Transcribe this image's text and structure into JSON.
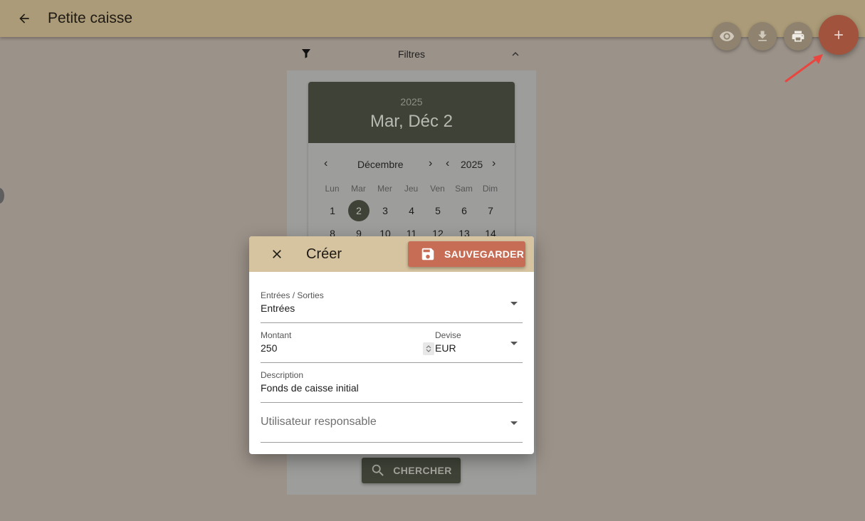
{
  "app": {
    "title": "Petite caisse"
  },
  "toolbar": {
    "view_icon": "eye-icon",
    "download_icon": "download-icon",
    "print_icon": "print-icon",
    "add_icon": "plus-icon"
  },
  "filters": {
    "label": "Filtres"
  },
  "datepicker": {
    "year": "2025",
    "selected_label": "Mar, Déc 2",
    "month": "Décembre",
    "nav_year": "2025",
    "weekdays": [
      "Lun",
      "Mar",
      "Mer",
      "Jeu",
      "Ven",
      "Sam",
      "Dim"
    ],
    "week1": [
      "1",
      "2",
      "3",
      "4",
      "5",
      "6",
      "7"
    ],
    "week2": [
      "8",
      "9",
      "10",
      "11",
      "12",
      "13",
      "14"
    ],
    "selected_day": "2"
  },
  "search": {
    "label": "CHERCHER"
  },
  "dialog": {
    "title": "Créer",
    "save_label": "SAUVEGARDER",
    "fields": {
      "type": {
        "label": "Entrées / Sorties",
        "value": "Entrées"
      },
      "amount": {
        "label": "Montant",
        "value": "250"
      },
      "currency": {
        "label": "Devise",
        "value": "EUR"
      },
      "description": {
        "label": "Description",
        "value": "Fonds de caisse initial"
      },
      "user": {
        "placeholder": "Utilisateur responsable"
      }
    }
  },
  "colors": {
    "appbar": "#ab9b78",
    "accent_dark": "#3f4337",
    "save_button": "#c86d55",
    "add_fab": "#a1533e",
    "dialog_header": "#d6c4a0",
    "arrow": "#e8463f"
  }
}
